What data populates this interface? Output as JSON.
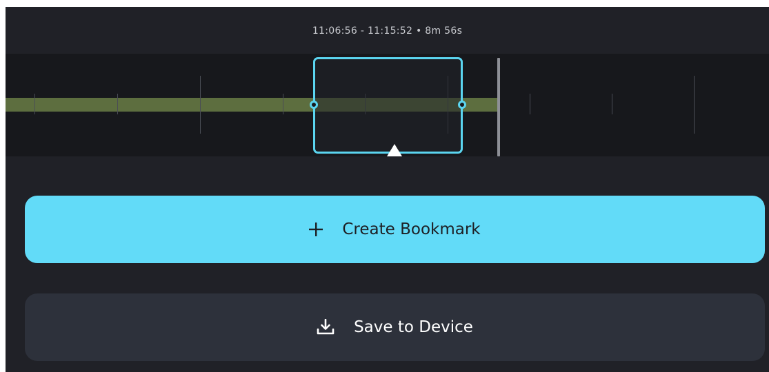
{
  "timeline": {
    "range_label": "11:06:56 - 11:15:52 • 8m 56s"
  },
  "actions": {
    "create_bookmark_label": "Create Bookmark",
    "save_to_device_label": "Save to Device"
  },
  "icons": {
    "create": "plus-icon",
    "save": "download-icon"
  },
  "colors": {
    "accent": "#62dbf8",
    "selection_border": "#5bd5f0",
    "recorded_segment": "#5d6e3f",
    "panel_background": "#202127",
    "timeline_background": "#17181c",
    "secondary_button": "#2d313b"
  }
}
